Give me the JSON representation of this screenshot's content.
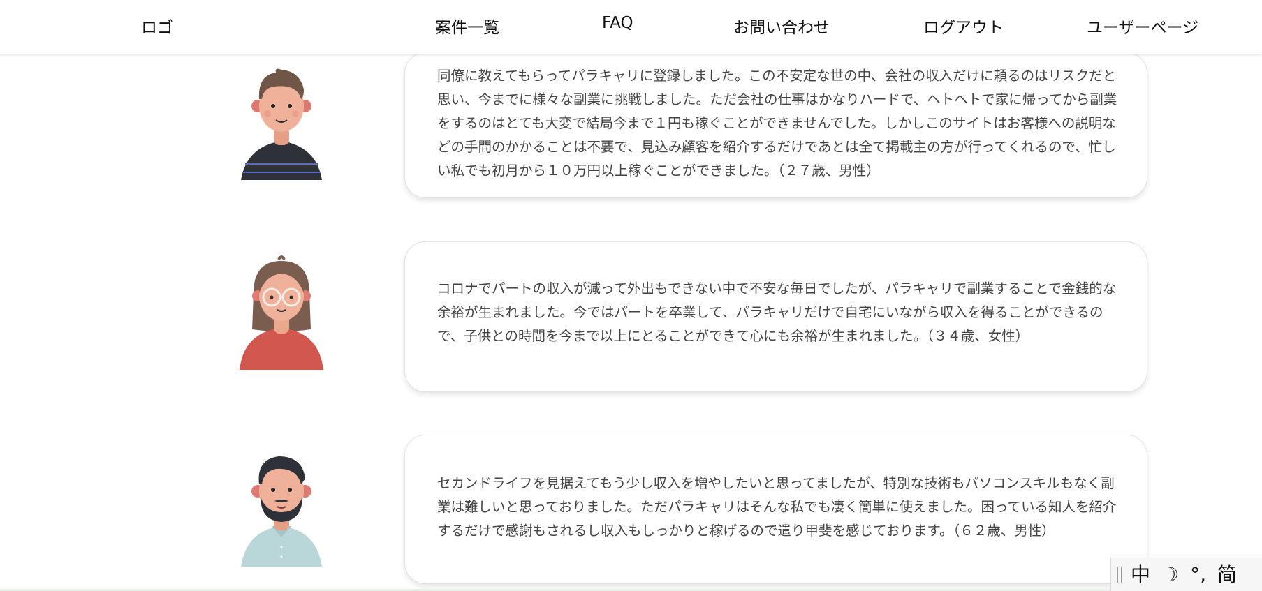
{
  "header": {
    "logo": "ロゴ",
    "nav": {
      "cases": "案件一覧",
      "faq": "FAQ",
      "contact": "お問い合わせ",
      "logout": "ログアウト",
      "user_page": "ユーザーページ"
    }
  },
  "testimonials": [
    {
      "text": "同僚に教えてもらってパラキャリに登録しました。この不安定な世の中、会社の収入だけに頼るのはリスクだと思い、今までに様々な副業に挑戦しました。ただ会社の仕事はかなりハードで、ヘトヘトで家に帰ってから副業をするのはとても大変で結局今まで１円も稼ぐことができませんでした。しかしこのサイトはお客様への説明などの手間のかかることは不要で、見込み顧客を紹介するだけであとは全て掲載主の方が行ってくれるので、忙しい私でも初月から１０万円以上稼ぐことができました。（２７歳、男性）"
    },
    {
      "text": "コロナでパートの収入が減って外出もできない中で不安な毎日でしたが、パラキャリで副業することで金銭的な余裕が生まれました。今ではパートを卒業して、パラキャリだけで自宅にいながら収入を得ることができるので、子供との時間を今まで以上にとることができて心にも余裕が生まれました。（３４歳、女性）"
    },
    {
      "text": "セカンドライフを見据えてもう少し収入を増やしたいと思ってましたが、特別な技術もパソコンスキルもなく副業は難しいと思っておりました。ただパラキャリはそんな私でも凄く簡単に使えました。困っている知人を紹介するだけで感謝もされるし収入もしっかりと稼げるので遣り甲斐を感じております。（６２歳、男性）"
    }
  ],
  "ime": {
    "mode": "中",
    "moon": "☽",
    "punct": "°,",
    "simplified": "简"
  }
}
